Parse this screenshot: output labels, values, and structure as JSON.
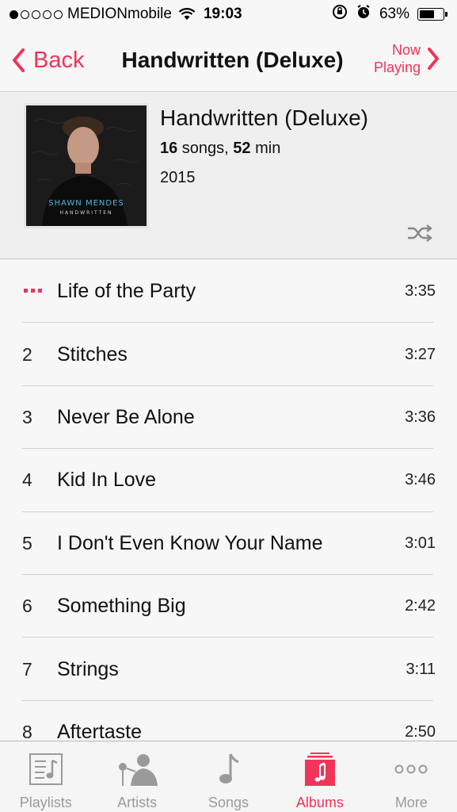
{
  "status_bar": {
    "carrier": "MEDIONmobile",
    "time": "19:03",
    "battery_percent": "63%",
    "battery_level": 0.63,
    "signal_bars_filled": 1,
    "signal_bars_total": 5
  },
  "nav": {
    "back_label": "Back",
    "title": "Handwritten (Deluxe)",
    "now_playing_line1": "Now",
    "now_playing_line2": "Playing"
  },
  "album": {
    "title": "Handwritten (Deluxe)",
    "song_count": "16",
    "songs_word": " songs, ",
    "duration": "52",
    "min_word": " min",
    "year": "2015",
    "art_artist": "SHAWN MENDES",
    "art_album": "HANDWRITTEN"
  },
  "tracks": [
    {
      "num": "",
      "title": "Life of the Party",
      "duration": "3:35",
      "playing": true
    },
    {
      "num": "2",
      "title": "Stitches",
      "duration": "3:27"
    },
    {
      "num": "3",
      "title": "Never Be Alone",
      "duration": "3:36"
    },
    {
      "num": "4",
      "title": "Kid In Love",
      "duration": "3:46"
    },
    {
      "num": "5",
      "title": "I Don't Even Know Your Name",
      "duration": "3:01"
    },
    {
      "num": "6",
      "title": "Something Big",
      "duration": "2:42"
    },
    {
      "num": "7",
      "title": "Strings",
      "duration": "3:11"
    },
    {
      "num": "8",
      "title": "Aftertaste",
      "duration": "2:50"
    }
  ],
  "tab_bar": {
    "tabs": [
      {
        "label": "Playlists",
        "icon": "playlists-icon"
      },
      {
        "label": "Artists",
        "icon": "artists-icon"
      },
      {
        "label": "Songs",
        "icon": "songs-icon"
      },
      {
        "label": "Albums",
        "icon": "albums-icon",
        "active": true
      },
      {
        "label": "More",
        "icon": "more-icon"
      }
    ]
  },
  "colors": {
    "accent": "#f0345a",
    "inactive": "#9a9a9a"
  }
}
